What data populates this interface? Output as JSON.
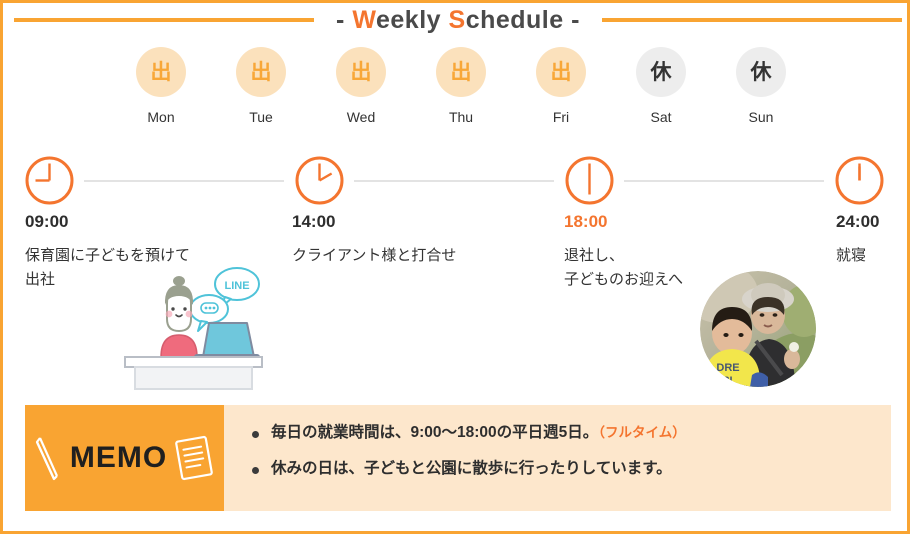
{
  "title": {
    "dash_left": "-",
    "dash_right": "-",
    "part1_cap": "W",
    "part1_rest": "eekly",
    "part2_cap": "S",
    "part2_rest": "chedule",
    "accent_color": "#F4752F",
    "rule_color": "#F9A432"
  },
  "week": {
    "days": [
      {
        "label": "Mon",
        "mark": "出",
        "type": "work"
      },
      {
        "label": "Tue",
        "mark": "出",
        "type": "work"
      },
      {
        "label": "Wed",
        "mark": "出",
        "type": "work"
      },
      {
        "label": "Thu",
        "mark": "出",
        "type": "work"
      },
      {
        "label": "Fri",
        "mark": "出",
        "type": "work"
      },
      {
        "label": "Sat",
        "mark": "休",
        "type": "off"
      },
      {
        "label": "Sun",
        "mark": "休",
        "type": "off"
      }
    ],
    "work_bg": "#FBE1BC",
    "work_fg": "#F8A738",
    "off_bg": "#EDEDED",
    "off_fg": "#333333"
  },
  "timeline": {
    "clock_color": "#F4752F",
    "line_color": "#E3E3E3",
    "entries": [
      {
        "time": "09:00",
        "desc": "保育園に子どもを預けて\n出社",
        "accent": false,
        "clock_hour_deg": 270,
        "clock_minute_deg": 0
      },
      {
        "time": "14:00",
        "desc": "クライアント様と打合せ",
        "accent": false,
        "clock_hour_deg": 60,
        "clock_minute_deg": 0
      },
      {
        "time": "18:00",
        "desc": "退社し、\n子どものお迎えへ",
        "accent": true,
        "clock_hour_deg": 180,
        "clock_minute_deg": 0
      },
      {
        "time": "24:00",
        "desc": "就寝",
        "accent": false,
        "clock_hour_deg": 0,
        "clock_minute_deg": 0
      }
    ]
  },
  "illustration": {
    "bubble_label": "LINE",
    "bubble_color": "#4FC3D9"
  },
  "photo": {
    "alt": "woman in hat with child outdoors"
  },
  "memo": {
    "heading": "MEMO",
    "head_bg": "#F9A432",
    "body_bg": "#FDE7CC",
    "items": [
      {
        "text": "毎日の就業時間は、9:00〜18:00の平日週5日。",
        "note": "（フルタイム）"
      },
      {
        "text": "休みの日は、子どもと公園に散歩に行ったりしています。",
        "note": ""
      }
    ]
  }
}
